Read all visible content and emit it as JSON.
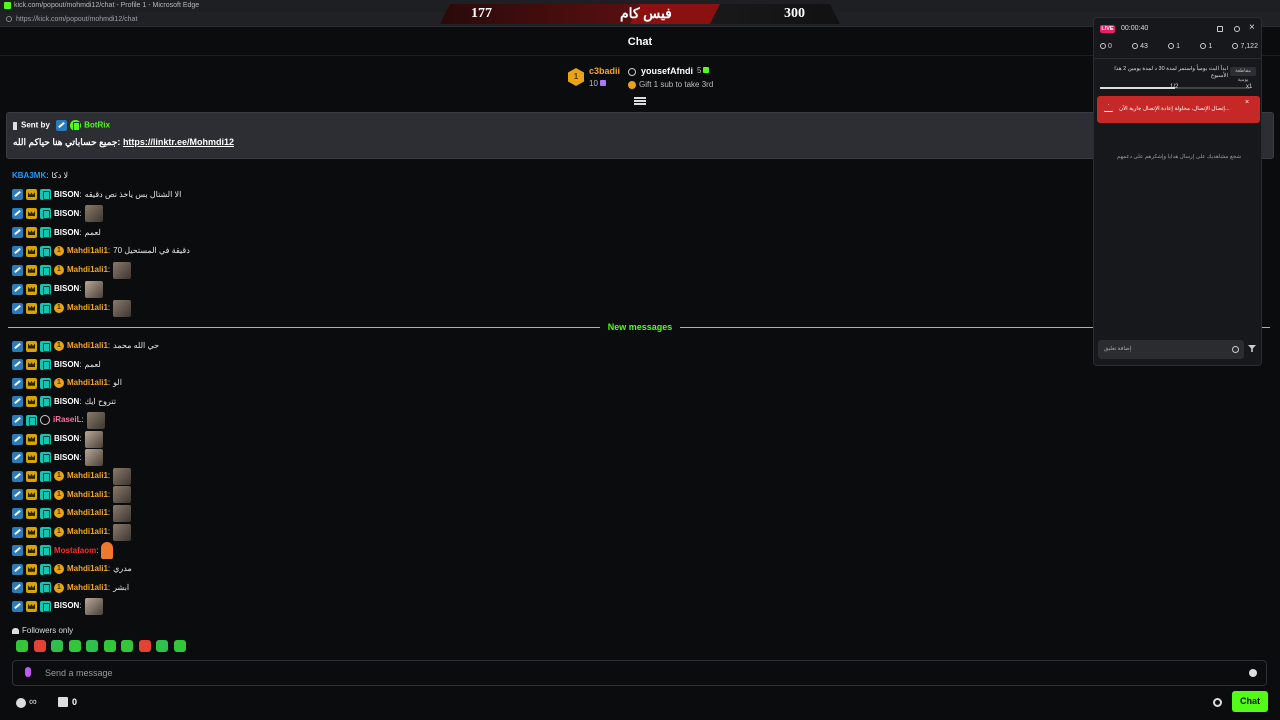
{
  "window": {
    "title": "kick.com/popout/mohmdi12/chat - Profile 1 - Microsoft Edge",
    "url": "https://kick.com/popout/mohmdi12/chat"
  },
  "score_overlay": {
    "left": "177",
    "center": "فيس كام",
    "right": "300"
  },
  "chat": {
    "title": "Chat",
    "leaderboard": [
      {
        "name": "c3badii",
        "count": "10",
        "rank": "1"
      },
      {
        "name": "yousefAfndi",
        "count": "5",
        "gift_text": "Gift 1 sub to take 3rd"
      }
    ],
    "pinned": {
      "sent_by_label": "Sent by",
      "sender": "BotRix",
      "text": "جميع حساباتي هنا حياكم الله:",
      "link": "https://linktr.ee/Mohmdi12"
    },
    "new_messages_label": "New messages",
    "followers_only": "Followers only",
    "input_placeholder": "Send a message",
    "chat_button": "Chat",
    "bottom_count": "0",
    "infinity": "∞"
  },
  "messages_before": [
    {
      "user": "KBA3MK",
      "color": "blue",
      "badges": [],
      "text": "لا دكا"
    },
    {
      "user": "BISON",
      "color": "white",
      "badges": [
        "blue",
        "crown",
        "teal"
      ],
      "text": "الا الشتال بس ياخذ نص دقيقه"
    },
    {
      "user": "BISON",
      "color": "white",
      "badges": [
        "blue",
        "crown",
        "teal"
      ],
      "emote": "photo"
    },
    {
      "user": "BISON",
      "color": "white",
      "badges": [
        "blue",
        "crown",
        "teal"
      ],
      "text": "لعمم"
    },
    {
      "user": "Mahdi1ali1",
      "color": "orange",
      "badges": [
        "blue",
        "crown",
        "teal",
        "gold"
      ],
      "text": "دقيقة في المستحيل 70"
    },
    {
      "user": "Mahdi1ali1",
      "color": "orange",
      "badges": [
        "blue",
        "crown",
        "teal",
        "gold"
      ],
      "emote": "photo"
    },
    {
      "user": "BISON",
      "color": "white",
      "badges": [
        "blue",
        "crown",
        "teal"
      ],
      "emote": "photo2"
    },
    {
      "user": "Mahdi1ali1",
      "color": "orange",
      "badges": [
        "blue",
        "crown",
        "teal",
        "gold"
      ],
      "emote": "photo"
    }
  ],
  "messages_after": [
    {
      "user": "Mahdi1ali1",
      "color": "orange",
      "badges": [
        "blue",
        "crown",
        "teal",
        "gold"
      ],
      "text": "حي الله محمد"
    },
    {
      "user": "BISON",
      "color": "white",
      "badges": [
        "blue",
        "crown",
        "teal"
      ],
      "text": "لعمم"
    },
    {
      "user": "Mahdi1ali1",
      "color": "orange",
      "badges": [
        "blue",
        "crown",
        "teal",
        "gold"
      ],
      "text": "الو"
    },
    {
      "user": "BISON",
      "color": "white",
      "badges": [
        "blue",
        "crown",
        "teal"
      ],
      "text": "تتروح ايك"
    },
    {
      "user": "iRaseiL",
      "color": "pink",
      "badges": [
        "blue",
        "teal",
        "hex"
      ],
      "emote": "photo"
    },
    {
      "user": "BISON",
      "color": "white",
      "badges": [
        "blue",
        "crown",
        "teal"
      ],
      "emote": "photo2"
    },
    {
      "user": "BISON",
      "color": "white",
      "badges": [
        "blue",
        "crown",
        "teal"
      ],
      "emote": "photo2"
    },
    {
      "user": "Mahdi1ali1",
      "color": "orange",
      "badges": [
        "blue",
        "crown",
        "teal",
        "gold"
      ],
      "emote": "photo"
    },
    {
      "user": "Mahdi1ali1",
      "color": "orange",
      "badges": [
        "blue",
        "crown",
        "teal",
        "gold"
      ],
      "emote": "photo"
    },
    {
      "user": "Mahdi1ali1",
      "color": "orange",
      "badges": [
        "blue",
        "crown",
        "teal",
        "gold"
      ],
      "emote": "photo"
    },
    {
      "user": "Mahdi1ali1",
      "color": "orange",
      "badges": [
        "blue",
        "crown",
        "teal",
        "gold"
      ],
      "emote": "photo"
    },
    {
      "user": "Mostafaom",
      "color": "red",
      "badges": [
        "blue",
        "crown",
        "teal"
      ],
      "emote": "bottle"
    },
    {
      "user": "Mahdi1ali1",
      "color": "orange",
      "badges": [
        "blue",
        "crown",
        "teal",
        "gold"
      ],
      "text": "مدري"
    },
    {
      "user": "Mahdi1ali1",
      "color": "orange",
      "badges": [
        "blue",
        "crown",
        "teal",
        "gold"
      ],
      "text": "ابشر"
    },
    {
      "user": "BISON",
      "color": "white",
      "badges": [
        "blue",
        "crown",
        "teal"
      ],
      "emote": "photo2"
    }
  ],
  "emote_bar_colors": [
    "#34c63a",
    "#e34234",
    "#2ec04a",
    "#34c63a",
    "#2ec04a",
    "#34c63a",
    "#34c63a",
    "#e34234",
    "#2ec04a",
    "#34c63a"
  ],
  "stream_panel": {
    "live": "LIVE",
    "time": "00:00:40",
    "stats": [
      "0",
      "43",
      "1",
      "1",
      "7,122"
    ],
    "goal_text": "ابدأ البث يومياً واستمر لمدة 30 د لمدة يومين 2 هذا الأسبوع",
    "goal_tag": "مقاطعة يومية",
    "progress": "1/2",
    "progress_fraction": 0.5,
    "mini": "x1",
    "alert_text": "إتصال الإتصال، محاولة إعادة الإتصال جارية الآن...",
    "alert_close": "×",
    "desc": "شجع مشاهديك على إرسال هدايا وإشكرهم على دعمهم",
    "input_placeholder": "إضافة تعليق"
  },
  "colors": {
    "accent": "#53fc18",
    "live": "#e91e63",
    "alert": "#c62828"
  }
}
